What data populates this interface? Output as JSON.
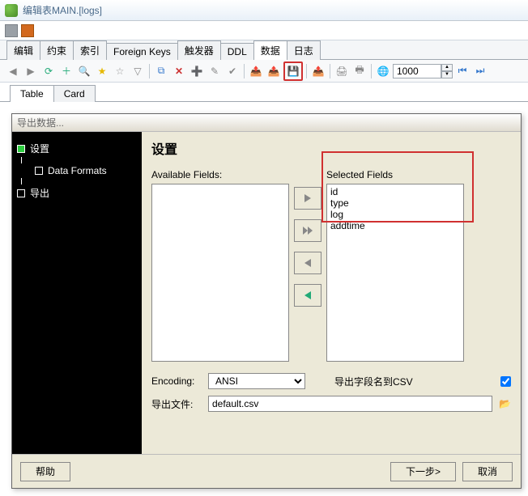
{
  "window": {
    "title": "编辑表MAIN.[logs]"
  },
  "tabs": [
    "编辑",
    "约束",
    "索引",
    "Foreign Keys",
    "触发器",
    "DDL",
    "数据",
    "日志"
  ],
  "tabs_active_index": 6,
  "toolbar": {
    "page_size": "1000"
  },
  "subtabs": [
    "Table",
    "Card"
  ],
  "subtabs_active_index": 0,
  "dialog": {
    "title": "导出数据...",
    "tree": [
      {
        "label": "设置",
        "active": true
      },
      {
        "label": "Data Formats",
        "child": true
      },
      {
        "label": "导出"
      }
    ],
    "heading": "设置",
    "available_label": "Available Fields:",
    "selected_label": "Selected Fields",
    "available_fields": [],
    "selected_fields": [
      "id",
      "type",
      "log",
      "addtime"
    ],
    "encoding_label": "Encoding:",
    "encoding_value": "ANSI",
    "export_fieldnames_label": "导出字段名到CSV",
    "export_fieldnames_checked": true,
    "file_label": "导出文件:",
    "file_value_prefix": "",
    "file_value_suffix": "default.csv",
    "help": "帮助",
    "next": "下一步>",
    "cancel": "取消"
  },
  "icons": {
    "arrow_left": "◀",
    "arrow_right": "▶",
    "refresh": "⟳",
    "plus": "＋",
    "search": "🔍",
    "star_y": "★",
    "star_g": "☆",
    "funnel": "▽",
    "copy": "⧉",
    "delete": "✕",
    "add_rec": "➕",
    "edit": "✎",
    "commit": "✔",
    "save": "💾",
    "export": "📤",
    "print": "🖨",
    "printer": "🖶",
    "globe": "🌐",
    "first": "⏮",
    "last": "⏭",
    "folder": "📂"
  }
}
